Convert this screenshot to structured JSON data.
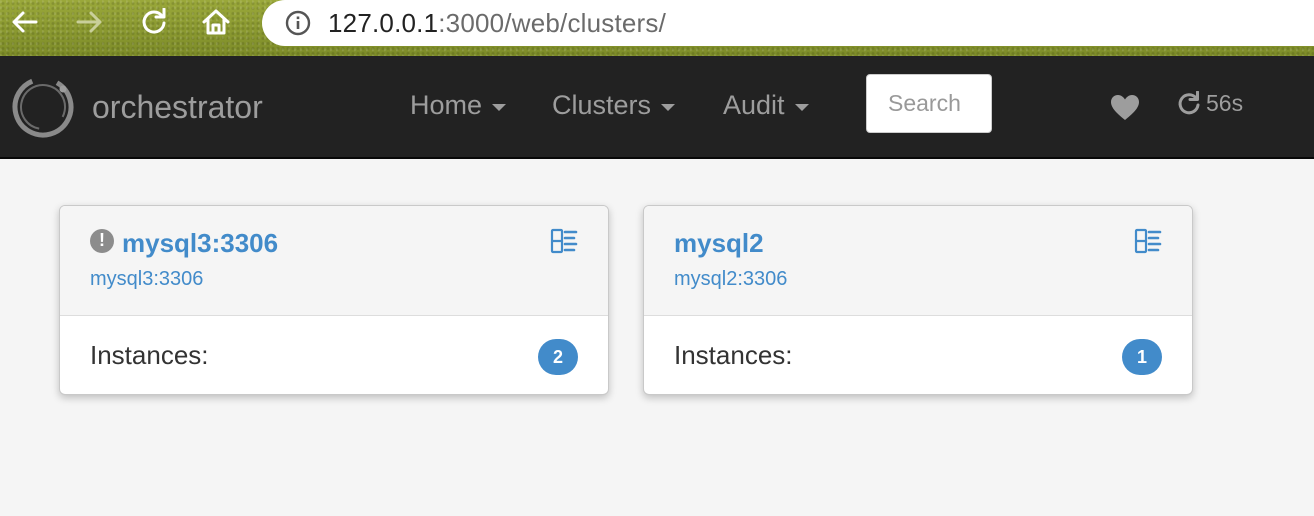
{
  "browser": {
    "url_host": "127.0.0.1",
    "url_rest": ":3000/web/clusters/"
  },
  "navbar": {
    "brand": "orchestrator",
    "menu": [
      {
        "label": "Home"
      },
      {
        "label": "Clusters"
      },
      {
        "label": "Audit"
      }
    ],
    "search_placeholder": "Search",
    "refresh_countdown": "56s"
  },
  "clusters": [
    {
      "title": "mysql3:3306",
      "alias": "mysql3:3306",
      "has_warning": true,
      "instances_label": "Instances:",
      "instances_count": "2"
    },
    {
      "title": "mysql2",
      "alias": "mysql2:3306",
      "has_warning": false,
      "instances_label": "Instances:",
      "instances_count": "1"
    }
  ],
  "colors": {
    "link": "#428bca",
    "navbar_bg": "#222222",
    "nav_text": "#9d9d9d",
    "badge": "#428bca"
  }
}
